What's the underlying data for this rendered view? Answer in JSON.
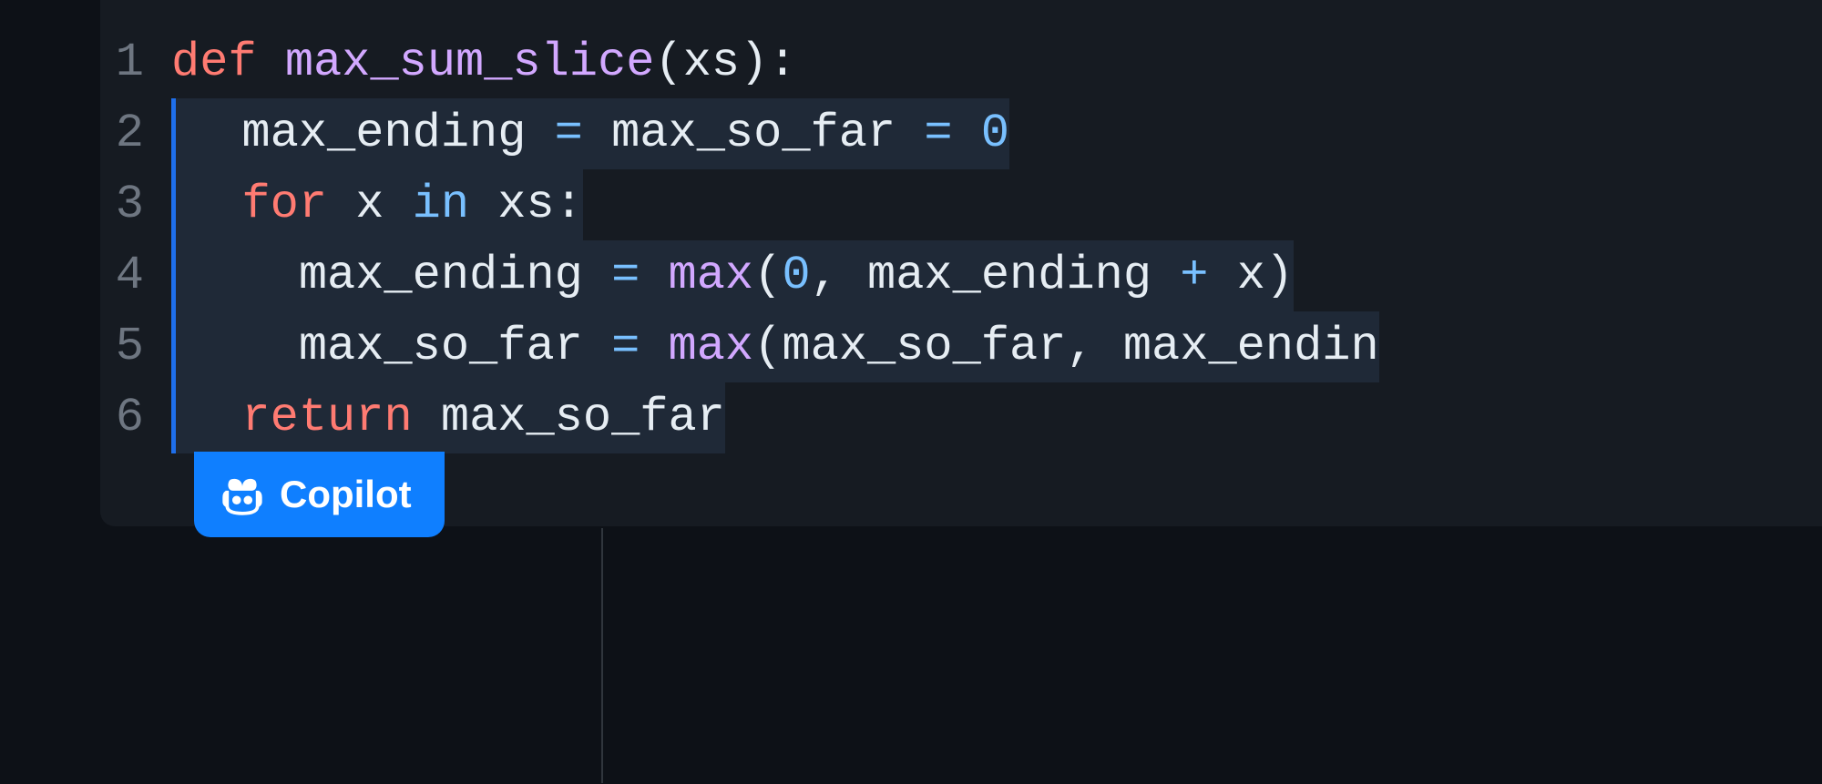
{
  "editor": {
    "lines": [
      {
        "number": "1",
        "suggestion": false,
        "tokens": [
          {
            "t": "def ",
            "c": "tok-keyword"
          },
          {
            "t": "max_sum_slice",
            "c": "tok-func"
          },
          {
            "t": "(",
            "c": "tok-punct"
          },
          {
            "t": "xs",
            "c": "tok-param"
          },
          {
            "t": "):",
            "c": "tok-punct"
          }
        ]
      },
      {
        "number": "2",
        "suggestion": true,
        "tokens": [
          {
            "t": "  max_ending ",
            "c": "tok-var"
          },
          {
            "t": "=",
            "c": "tok-op"
          },
          {
            "t": " max_so_far ",
            "c": "tok-var"
          },
          {
            "t": "=",
            "c": "tok-op"
          },
          {
            "t": " ",
            "c": "tok-var"
          },
          {
            "t": "0",
            "c": "tok-num"
          }
        ]
      },
      {
        "number": "3",
        "suggestion": true,
        "tokens": [
          {
            "t": "  ",
            "c": "tok-var"
          },
          {
            "t": "for",
            "c": "tok-keyword"
          },
          {
            "t": " x ",
            "c": "tok-var"
          },
          {
            "t": "in",
            "c": "tok-in"
          },
          {
            "t": " xs",
            "c": "tok-var"
          },
          {
            "t": ":",
            "c": "tok-punct"
          }
        ]
      },
      {
        "number": "4",
        "suggestion": true,
        "tokens": [
          {
            "t": "    max_ending ",
            "c": "tok-var"
          },
          {
            "t": "=",
            "c": "tok-op"
          },
          {
            "t": " ",
            "c": "tok-var"
          },
          {
            "t": "max",
            "c": "tok-builtin"
          },
          {
            "t": "(",
            "c": "tok-punct"
          },
          {
            "t": "0",
            "c": "tok-num"
          },
          {
            "t": ",",
            "c": "tok-punct"
          },
          {
            "t": " max_ending ",
            "c": "tok-var"
          },
          {
            "t": "+",
            "c": "tok-op"
          },
          {
            "t": " x",
            "c": "tok-var"
          },
          {
            "t": ")",
            "c": "tok-punct"
          }
        ]
      },
      {
        "number": "5",
        "suggestion": true,
        "tokens": [
          {
            "t": "    max_so_far ",
            "c": "tok-var"
          },
          {
            "t": "=",
            "c": "tok-op"
          },
          {
            "t": " ",
            "c": "tok-var"
          },
          {
            "t": "max",
            "c": "tok-builtin"
          },
          {
            "t": "(",
            "c": "tok-punct"
          },
          {
            "t": "max_so_far",
            "c": "tok-var"
          },
          {
            "t": ",",
            "c": "tok-punct"
          },
          {
            "t": " max_endin",
            "c": "tok-var"
          }
        ]
      },
      {
        "number": "6",
        "suggestion": true,
        "tokens": [
          {
            "t": "  ",
            "c": "tok-var"
          },
          {
            "t": "return",
            "c": "tok-keyword"
          },
          {
            "t": " max_so_far",
            "c": "tok-var"
          }
        ]
      }
    ]
  },
  "copilot": {
    "label": "Copilot"
  }
}
